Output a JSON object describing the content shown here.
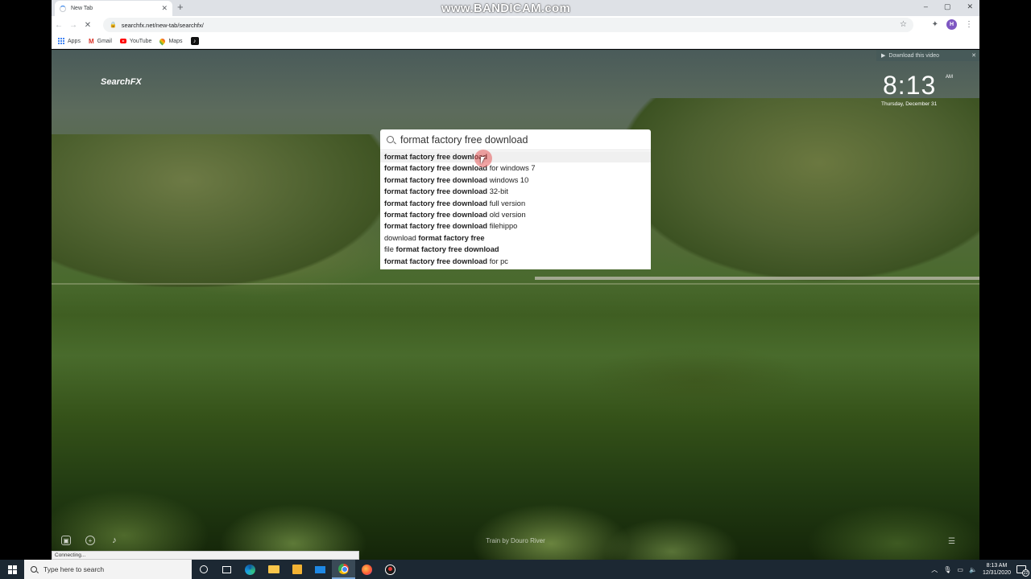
{
  "watermark": "www.BANDICAM.com",
  "browser": {
    "tab_title": "New Tab",
    "new_tab_symbol": "+",
    "url": "searchfx.net/new-tab/searchfx/",
    "window_controls": {
      "minimize": "–",
      "maximize": "▢",
      "close": "✕"
    },
    "profile_initial": "H",
    "bookmarks": [
      {
        "label": "Apps"
      },
      {
        "label": "Gmail"
      },
      {
        "label": "YouTube"
      },
      {
        "label": "Maps"
      }
    ],
    "status_text": "Connecting..."
  },
  "page": {
    "brand": "SearchFX",
    "clock_time": "8:13",
    "clock_ampm": "AM",
    "clock_date": "Thursday, December 31",
    "download_video_label": "Download this video",
    "search_query": "format factory free download",
    "suggestions": [
      {
        "bold": "format factory free download",
        "rest": ""
      },
      {
        "bold": "format factory free download",
        "rest": " for windows 7"
      },
      {
        "bold": "format factory free download",
        "rest": " windows 10"
      },
      {
        "bold": "format factory free download",
        "rest": " 32-bit"
      },
      {
        "bold": "format factory free download",
        "rest": " full version"
      },
      {
        "bold": "format factory free download",
        "rest": " old version"
      },
      {
        "bold": "format factory free download",
        "rest": " filehippo"
      },
      {
        "pre": "download ",
        "bold": "format factory free",
        "rest": ""
      },
      {
        "pre": "file ",
        "bold": "format factory free download",
        "rest": ""
      },
      {
        "bold": "format factory free download",
        "rest": " for pc"
      }
    ],
    "background_caption": "Train by Douro River"
  },
  "taskbar": {
    "search_placeholder": "Type here to search",
    "time": "8:13 AM",
    "date": "12/31/2020",
    "notification_count": "22"
  }
}
